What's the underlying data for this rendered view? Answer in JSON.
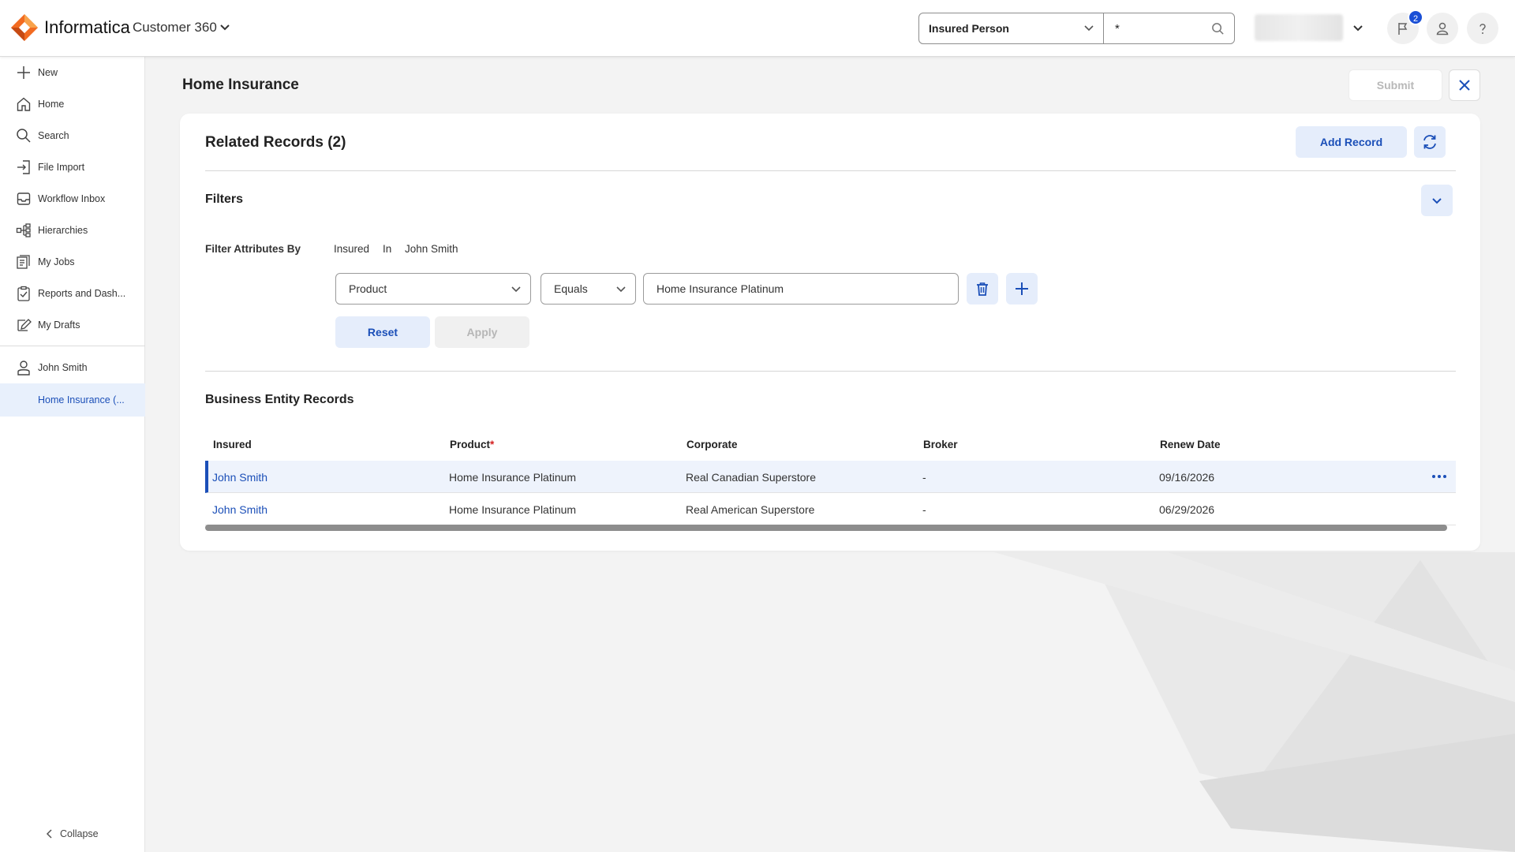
{
  "header": {
    "brand": "Informatica",
    "product": "Customer 360",
    "search_type": "Insured Person",
    "search_value": "*",
    "notification_count": "2"
  },
  "sidebar": {
    "items": [
      {
        "label": "New",
        "icon": "plus-icon"
      },
      {
        "label": "Home",
        "icon": "home-icon"
      },
      {
        "label": "Search",
        "icon": "search-icon"
      },
      {
        "label": "File Import",
        "icon": "file-import-icon"
      },
      {
        "label": "Workflow Inbox",
        "icon": "inbox-icon"
      },
      {
        "label": "Hierarchies",
        "icon": "hierarchy-icon"
      },
      {
        "label": "My Jobs",
        "icon": "jobs-icon"
      },
      {
        "label": "Reports and Dash...",
        "icon": "reports-icon"
      },
      {
        "label": "My Drafts",
        "icon": "drafts-icon"
      }
    ],
    "record": {
      "label": "John Smith",
      "icon": "person-icon"
    },
    "subitem": "Home Insurance (...",
    "collapse": "Collapse"
  },
  "main": {
    "page_title": "Home Insurance",
    "submit": "Submit",
    "card_title": "Related Records (2)",
    "add_record": "Add Record",
    "filters": {
      "title": "Filters",
      "attributes_label": "Filter Attributes By",
      "criteria": [
        "Insured",
        "In",
        "John Smith"
      ],
      "field": "Product",
      "operator": "Equals",
      "value": "Home Insurance Platinum",
      "reset": "Reset",
      "apply": "Apply"
    },
    "records": {
      "title": "Business Entity Records",
      "columns": [
        "Insured",
        "Product",
        "Corporate",
        "Broker",
        "Renew Date"
      ],
      "required_mark": "*",
      "rows": [
        [
          "John Smith",
          "Home Insurance Platinum",
          "Real Canadian Superstore",
          "-",
          "09/16/2026"
        ],
        [
          "John Smith",
          "Home Insurance Platinum",
          "Real American Superstore",
          "-",
          "06/29/2026"
        ]
      ]
    }
  },
  "colors": {
    "accent": "#1b4fb8",
    "accent_light": "#e5edfb",
    "logo_orange": "#f26b21",
    "logo_dark_orange": "#c64a13"
  }
}
